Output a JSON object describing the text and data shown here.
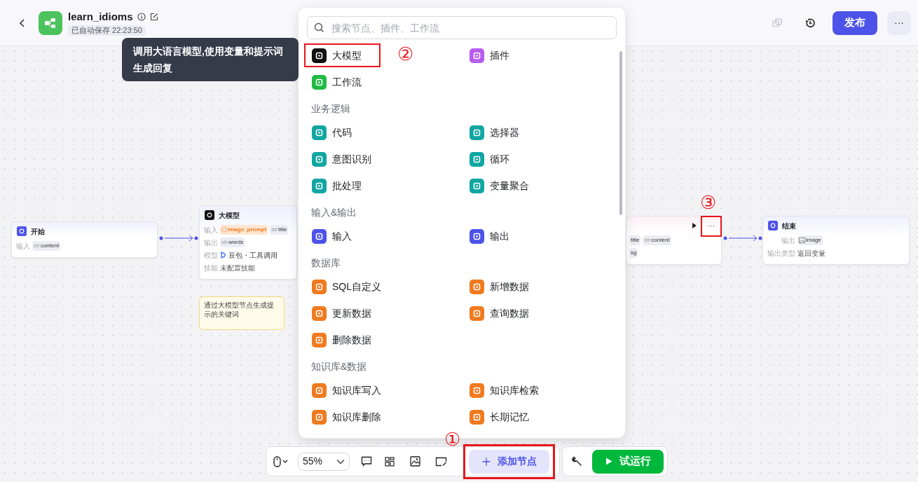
{
  "header": {
    "title": "learn_idioms",
    "autosave": "已自动保存 22:23:50",
    "publish": "发布",
    "more": "···"
  },
  "tooltip": {
    "text": "调用大语言模型,使用变量和提示词生成回复"
  },
  "canvas": {
    "nodes": [
      {
        "kind": "start",
        "title": "开始",
        "rows": [
          {
            "label": "输入",
            "chips": [
              {
                "type": "str",
                "name": "content"
              }
            ]
          }
        ]
      },
      {
        "kind": "llm",
        "title": "大模型",
        "rows": [
          {
            "label": "输入",
            "chips": [
              {
                "warn": true,
                "name": "image_prompt"
              },
              {
                "type": "str",
                "name": "title"
              }
            ]
          },
          {
            "label": "输出",
            "chips": [
              {
                "type": "str",
                "name": "words"
              }
            ]
          },
          {
            "label": "模型",
            "model": "豆包・工具调用"
          },
          {
            "label": "技能",
            "value": "未配置技能"
          }
        ]
      },
      {
        "kind": "partial",
        "more": "···",
        "callout": "③",
        "rows": [
          {
            "chips": [
              {
                "name": "title"
              },
              {
                "type": "str",
                "name": "content"
              }
            ]
          },
          {
            "chips": [
              {
                "name": "sg"
              }
            ]
          }
        ]
      },
      {
        "kind": "end",
        "title": "结束",
        "rows": [
          {
            "label": "输出",
            "chips": [
              {
                "image": true,
                "name": "image"
              }
            ]
          },
          {
            "label": "输出类型",
            "value": "返回变量"
          }
        ]
      }
    ],
    "note": "通过大模型节点生成提示的关键词"
  },
  "node_panel": {
    "search": {
      "placeholder": "搜索节点、插件、工作流"
    },
    "groups": [
      {
        "items": [
          {
            "label": "大模型",
            "color": "#111111",
            "highlighted": true,
            "callout": "②"
          },
          {
            "label": "插件",
            "color": "#b85cf0",
            "highlighted": false
          },
          {
            "label": "工作流",
            "color": "#1fba45",
            "highlighted": false
          }
        ]
      },
      {
        "heading": "业务逻辑",
        "items": [
          {
            "label": "代码",
            "color": "#11a6a1",
            "highlighted": false
          },
          {
            "label": "选择器",
            "color": "#11a6a1",
            "highlighted": false
          },
          {
            "label": "意图识别",
            "color": "#11a6a1",
            "highlighted": false
          },
          {
            "label": "循环",
            "color": "#11a6a1",
            "highlighted": false
          },
          {
            "label": "批处理",
            "color": "#11a6a1",
            "highlighted": false
          },
          {
            "label": "变量聚合",
            "color": "#11a6a1",
            "highlighted": false
          }
        ]
      },
      {
        "heading": "输入&输出",
        "items": [
          {
            "label": "输入",
            "color": "#4d53e8",
            "highlighted": false
          },
          {
            "label": "输出",
            "color": "#4d53e8",
            "highlighted": false
          }
        ]
      },
      {
        "heading": "数据库",
        "items": [
          {
            "label": "SQL自定义",
            "color": "#f07a1f",
            "highlighted": false
          },
          {
            "label": "新增数据",
            "color": "#f07a1f",
            "highlighted": false
          },
          {
            "label": "更新数据",
            "color": "#f07a1f",
            "highlighted": false
          },
          {
            "label": "查询数据",
            "color": "#f07a1f",
            "highlighted": false
          },
          {
            "label": "删除数据",
            "color": "#f07a1f",
            "highlighted": false
          }
        ]
      },
      {
        "heading": "知识库&数据",
        "items": [
          {
            "label": "知识库写入",
            "color": "#f07a1f",
            "highlighted": false
          },
          {
            "label": "知识库检索",
            "color": "#f07a1f",
            "highlighted": false
          },
          {
            "label": "知识库删除",
            "color": "#f07a1f",
            "highlighted": false
          },
          {
            "label": "长期记忆",
            "color": "#f07a1f",
            "highlighted": false
          }
        ]
      }
    ]
  },
  "toolbar": {
    "zoom": "55%",
    "add_node": {
      "label": "添加节点",
      "highlighted": true,
      "callout": "①"
    },
    "test_run": "试运行"
  }
}
